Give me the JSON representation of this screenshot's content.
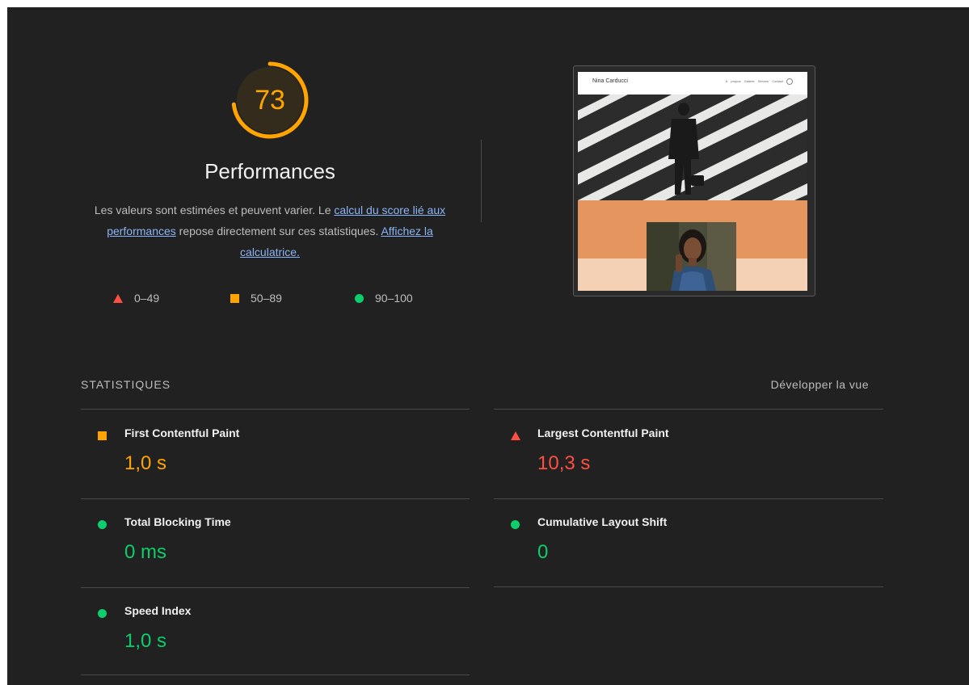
{
  "score": {
    "value": "73",
    "fraction": 0.73,
    "color": "#ffa400"
  },
  "category": {
    "title": "Performances",
    "desc_before": "Les valeurs sont estimées et peuvent varier. Le ",
    "link1": "calcul du score lié aux performances",
    "desc_middle": " repose directement sur ces statistiques. ",
    "link2": "Affichez la calculatrice."
  },
  "legend": [
    {
      "icon": "triangle-red-icon",
      "label": "0–49",
      "color": "#ff4e42"
    },
    {
      "icon": "square-orange-icon",
      "label": "50–89",
      "color": "#ffa400"
    },
    {
      "icon": "circle-green-icon",
      "label": "90–100",
      "color": "#0cce6b"
    }
  ],
  "screenshot": {
    "brand": "Nina Carducci",
    "nav": "À propos Galerie Service Contact"
  },
  "metrics_section": {
    "label": "STATISTIQUES",
    "expand": "Développer la vue"
  },
  "metrics": [
    {
      "title": "First Contentful Paint",
      "value": "1,0 s",
      "status": "average",
      "icon": "square-orange-icon"
    },
    {
      "title": "Largest Contentful Paint",
      "value": "10,3 s",
      "status": "fail",
      "icon": "triangle-red-icon"
    },
    {
      "title": "Total Blocking Time",
      "value": "0 ms",
      "status": "pass",
      "icon": "circle-green-icon"
    },
    {
      "title": "Cumulative Layout Shift",
      "value": "0",
      "status": "pass",
      "icon": "circle-green-icon"
    },
    {
      "title": "Speed Index",
      "value": "1,0 s",
      "status": "pass",
      "icon": "circle-green-icon"
    }
  ],
  "colors": {
    "background": "#212121",
    "pass": "#0cce6b",
    "average": "#ffa400",
    "fail": "#ff4e42",
    "link": "#8ab4f8"
  }
}
